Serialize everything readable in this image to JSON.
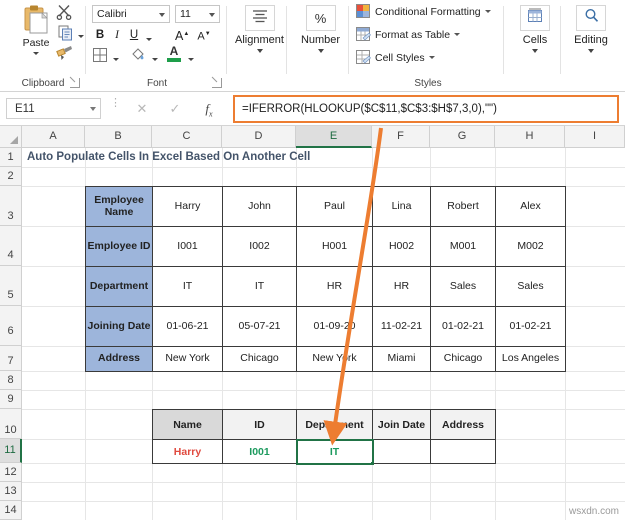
{
  "ribbon": {
    "clipboard": {
      "group_label": "Clipboard",
      "paste_label": "Paste",
      "cut_icon": "scissors-icon",
      "copy_icon": "copy-icon",
      "format_painter_icon": "paintbrush-icon",
      "paste_icon": "clipboard-icon"
    },
    "font": {
      "group_label": "Font",
      "font_name": "Calibri",
      "font_size": "11",
      "bold": "B",
      "italic": "I",
      "underline": "U",
      "increase_size": "A",
      "decrease_size": "A",
      "borders_icon": "borders-icon",
      "fill_color_icon": "fill-color-icon",
      "font_color_icon": "font-color-icon",
      "font_color": "#1E9E4A"
    },
    "alignment": {
      "group_label": "Alignment",
      "icon": "align-center-icon"
    },
    "number": {
      "group_label": "Number",
      "icon": "percent-icon",
      "glyph": "%"
    },
    "styles": {
      "group_label": "Styles",
      "items": [
        {
          "label": "Conditional Formatting",
          "icon": "conditional-formatting-icon"
        },
        {
          "label": "Format as Table",
          "icon": "format-as-table-icon"
        },
        {
          "label": "Cell Styles",
          "icon": "cell-styles-icon"
        }
      ]
    },
    "cells": {
      "group_label": "",
      "label": "Cells",
      "icon": "cells-icon"
    },
    "editing": {
      "group_label": "",
      "label": "Editing",
      "icon": "magnifier-icon"
    }
  },
  "formula_bar": {
    "name_box_value": "E11",
    "cancel_icon": "close-icon",
    "confirm_icon": "check-icon",
    "function_icon": "fx-icon",
    "formula": "=IFERROR(HLOOKUP($C$11,$C$3:$H$7,3,0),\"\")",
    "highlight_color": "#ED7D31"
  },
  "grid": {
    "column_headers": [
      "A",
      "B",
      "C",
      "D",
      "E",
      "F",
      "G",
      "H",
      "I"
    ],
    "selected_column": "E",
    "row_headers": [
      "1",
      "2",
      "3",
      "4",
      "5",
      "6",
      "7",
      "8",
      "9",
      "10",
      "11",
      "12",
      "13",
      "14"
    ],
    "selected_row": "11",
    "sheet_title": "Auto Populate Cells In Excel Based On Another Cell"
  },
  "data_table": {
    "row_labels": [
      "Employee Name",
      "Employee ID",
      "Department",
      "Joining Date",
      "Address"
    ],
    "columns": [
      {
        "name": "Harry",
        "id": "I001",
        "department": "IT",
        "joining_date": "01-06-21",
        "address": "New York"
      },
      {
        "name": "John",
        "id": "I002",
        "department": "IT",
        "joining_date": "05-07-21",
        "address": "Chicago"
      },
      {
        "name": "Paul",
        "id": "H001",
        "department": "HR",
        "joining_date": "01-09-20",
        "address": "New York"
      },
      {
        "name": "Lina",
        "id": "H002",
        "department": "HR",
        "joining_date": "11-02-21",
        "address": "Miami"
      },
      {
        "name": "Robert",
        "id": "M001",
        "department": "Sales",
        "joining_date": "01-02-21",
        "address": "Chicago"
      },
      {
        "name": "Alex",
        "id": "M002",
        "department": "Sales",
        "joining_date": "01-02-21",
        "address": "Los Angeles"
      }
    ]
  },
  "result_table": {
    "headers": [
      "Name",
      "ID",
      "Department",
      "Join Date",
      "Address"
    ],
    "values": [
      "Harry",
      "I001",
      "IT",
      "",
      ""
    ],
    "selected_cell_index": 2,
    "name_color": "#E04A3F",
    "value_color": "#1C9A5E"
  },
  "watermark": "wsxdn.com"
}
